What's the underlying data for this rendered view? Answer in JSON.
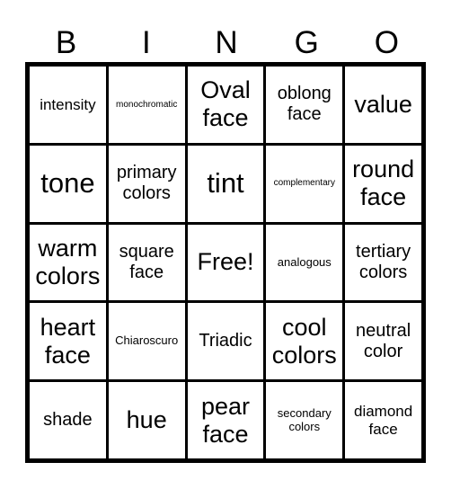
{
  "header": [
    "B",
    "I",
    "N",
    "G",
    "O"
  ],
  "cells": [
    "intensity",
    "monochromatic",
    "Oval face",
    "oblong face",
    "value",
    "tone",
    "primary colors",
    "tint",
    "complementary",
    "round face",
    "warm colors",
    "square face",
    "Free!",
    "analogous",
    "tertiary colors",
    "heart face",
    "Chiaroscuro",
    "Triadic",
    "cool colors",
    "neutral color",
    "shade",
    "hue",
    "pear face",
    "secondary colors",
    "diamond face"
  ]
}
